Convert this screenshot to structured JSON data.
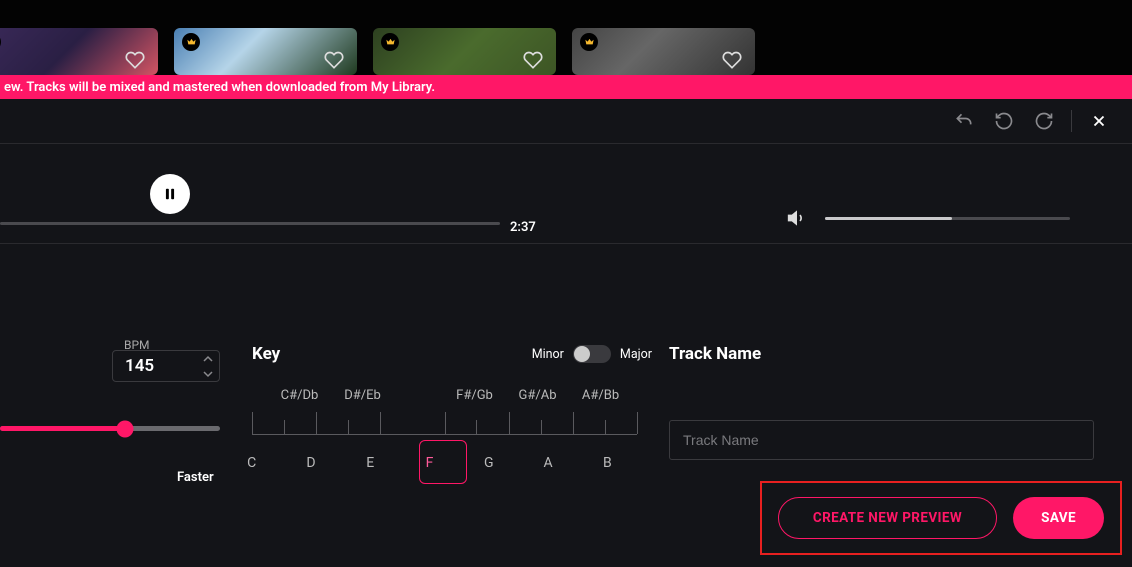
{
  "banner": "ew. Tracks will be mixed and mastered when downloaded from My Library.",
  "player": {
    "time": "2:37",
    "volume_pct": 52,
    "seek_pct": 100
  },
  "bpm": {
    "label": "BPM",
    "value": "145",
    "slider_pct": 57,
    "faster_label": "Faster"
  },
  "key": {
    "label": "Key",
    "mode_left": "Minor",
    "mode_right": "Major",
    "sharps": [
      "C#/Db",
      "D#/Eb",
      "",
      "F#/Gb",
      "G#/Ab",
      "A#/Bb",
      ""
    ],
    "naturals": [
      "C",
      "D",
      "E",
      "F",
      "G",
      "A",
      "B"
    ],
    "selected": "F"
  },
  "track": {
    "label": "Track Name",
    "placeholder": "Track Name",
    "value": ""
  },
  "actions": {
    "preview": "CREATE NEW PREVIEW",
    "save": "SAVE"
  },
  "colors": {
    "accent": "#ff1767"
  }
}
